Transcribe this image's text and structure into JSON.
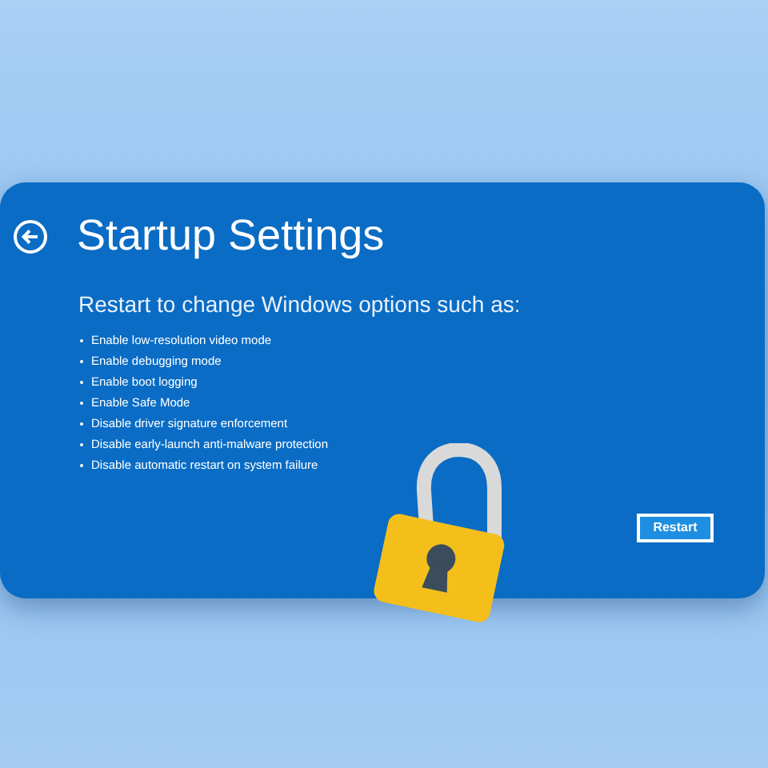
{
  "screen": {
    "title": "Startup Settings",
    "subtitle": "Restart to change Windows options such as:",
    "options": [
      "Enable low-resolution video mode",
      "Enable debugging mode",
      "Enable boot logging",
      "Enable Safe Mode",
      "Disable driver signature enforcement",
      "Disable early-launch anti-malware protection",
      "Disable automatic restart on system failure"
    ],
    "buttons": [
      "Restart"
    ]
  }
}
